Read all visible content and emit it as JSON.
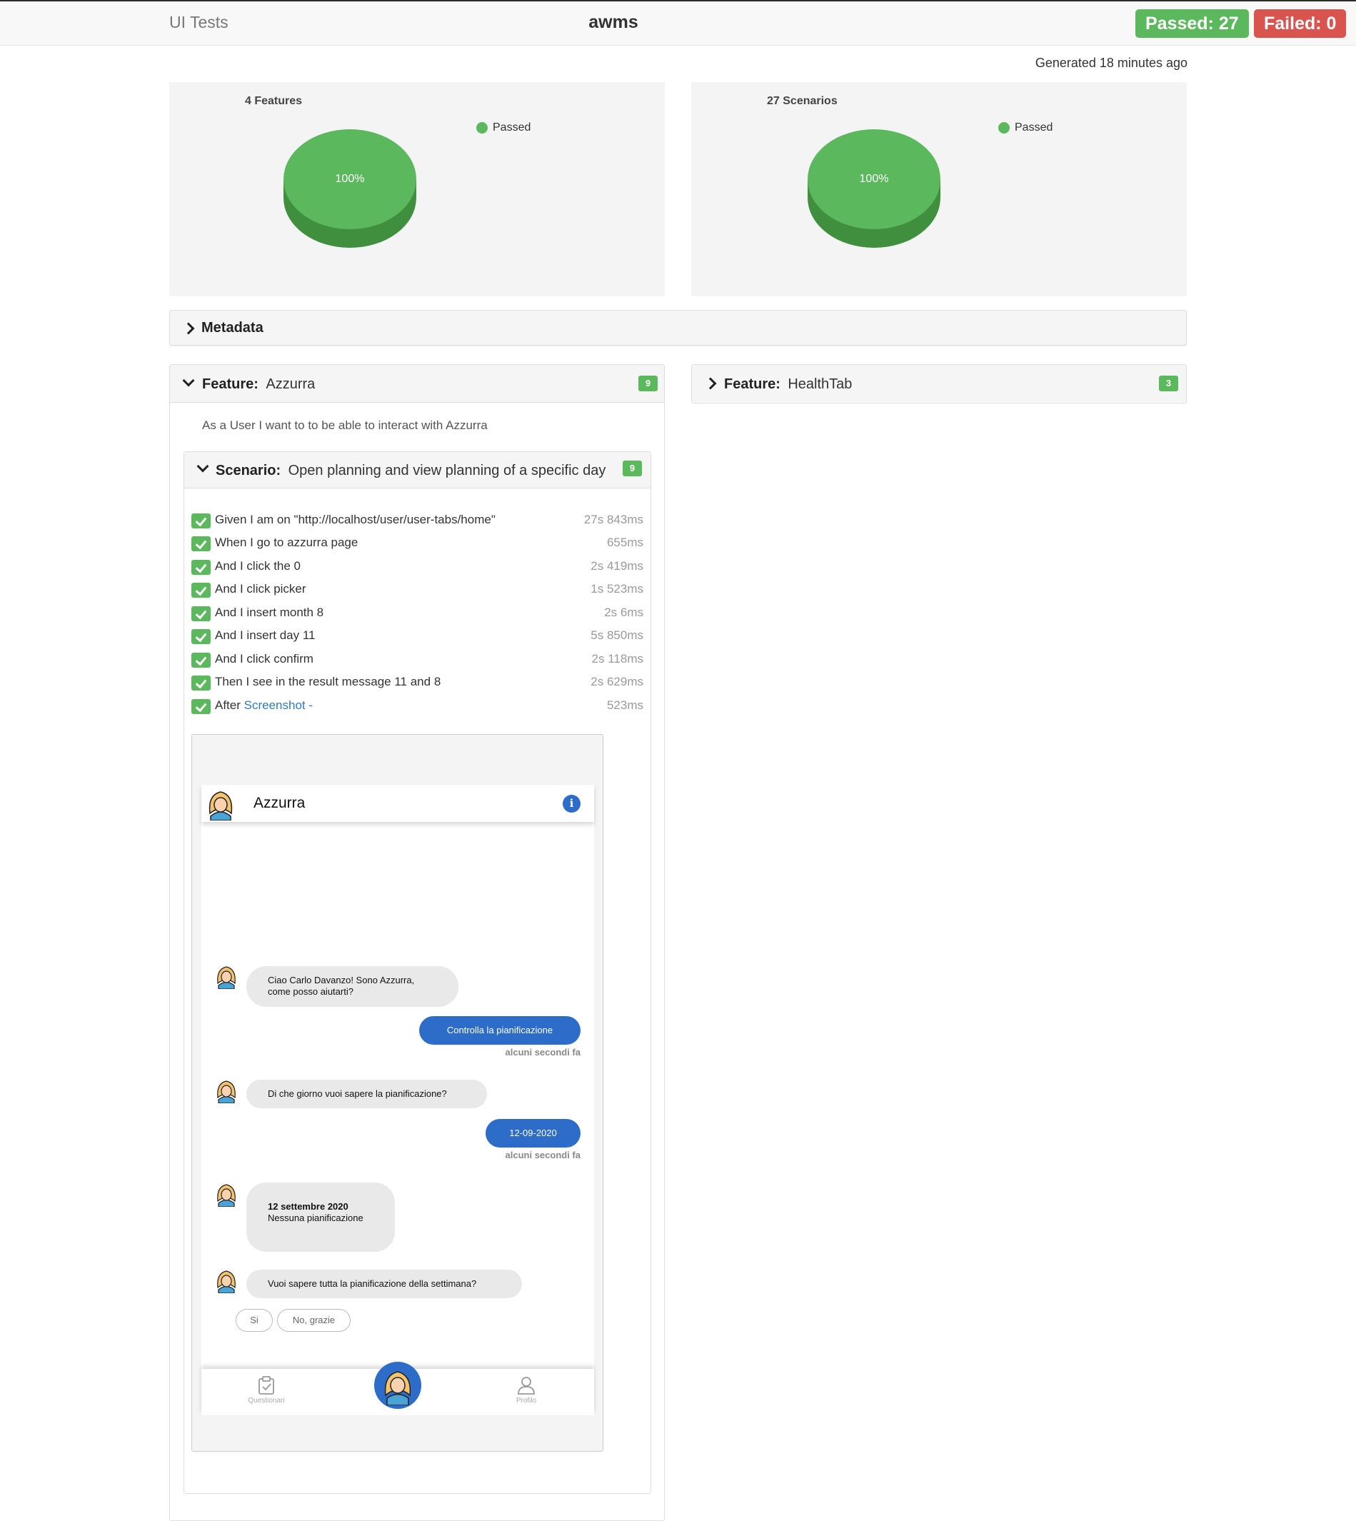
{
  "header": {
    "brand": "UI Tests",
    "project": "awms",
    "passed_label": "Passed: 27",
    "failed_label": "Failed: 0"
  },
  "generated": "Generated 18 minutes ago",
  "charts": [
    {
      "title": "4 Features",
      "legend": "Passed",
      "slice_label": "100%",
      "color": "#5cb85c"
    },
    {
      "title": "27 Scenarios",
      "legend": "Passed",
      "slice_label": "100%",
      "color": "#5cb85c"
    }
  ],
  "chart_data": [
    {
      "type": "pie",
      "title": "4 Features",
      "categories": [
        "Passed"
      ],
      "values": [
        100
      ],
      "legend": "top-right"
    },
    {
      "type": "pie",
      "title": "27 Scenarios",
      "categories": [
        "Passed"
      ],
      "values": [
        100
      ],
      "legend": "top-right"
    }
  ],
  "metadata": {
    "label": "Metadata"
  },
  "features": [
    {
      "keyword": "Feature:",
      "name": "Azzurra",
      "count": "9",
      "description": "As a User I want to to be able to interact with Azzurra",
      "scenario": {
        "keyword": "Scenario:",
        "name": "Open planning and view planning of a specific day",
        "count": "9",
        "steps": [
          {
            "text": "Given I am on \"http://localhost/user/user-tabs/home\"",
            "time": "27s 843ms"
          },
          {
            "text": "When I go to azzurra page",
            "time": "655ms"
          },
          {
            "text": "And I click the 0",
            "time": "2s 419ms"
          },
          {
            "text": "And I click picker",
            "time": "1s 523ms"
          },
          {
            "text": "And I insert month 8",
            "time": "2s 6ms"
          },
          {
            "text": "And I insert day 11",
            "time": "5s 850ms"
          },
          {
            "text": "And I click confirm",
            "time": "2s 118ms"
          },
          {
            "text": "Then I see in the result message 11 and 8",
            "time": "2s 629ms"
          },
          {
            "text": "After",
            "link": "Screenshot -",
            "time": "523ms"
          }
        ]
      }
    },
    {
      "keyword": "Feature:",
      "name": "HealthTab",
      "count": "3"
    }
  ],
  "screenshot": {
    "app_title": "Azzurra",
    "info_icon": "i",
    "messages": {
      "m1": "Ciao Carlo Davanzo! Sono Azzurra, come posso aiutarti?",
      "r1": "Controlla la pianificazione",
      "t1": "alcuni secondi fa",
      "m2": "Di che giorno vuoi sapere la pianificazione?",
      "r2": "12-09-2020",
      "t2": "alcuni secondi fa",
      "m3_bold": "12 settembre 2020",
      "m3_text": "Nessuna pianificazione",
      "m4": "Vuoi sapere tutta la pianificazione della settimana?"
    },
    "chips": [
      "Si",
      "No, grazie"
    ],
    "tabs": {
      "left": "Questionari",
      "right": "Profilo"
    },
    "colors": {
      "accent": "#2d6cc9",
      "passed": "#5cb85c",
      "failed": "#d9534f"
    }
  }
}
